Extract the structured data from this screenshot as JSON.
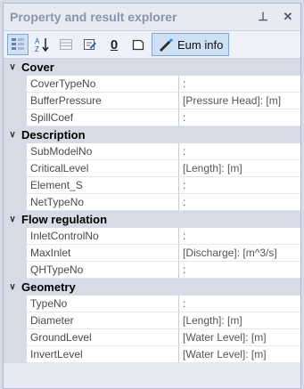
{
  "window": {
    "title": "Property and result explorer",
    "pin_glyph": "⊥",
    "close_glyph": "✕"
  },
  "toolbar": {
    "categorized_icon": "categorized-icon",
    "sort_glyph": "A↓Z",
    "grid_icon": "grid-icon",
    "edit_icon": "edit-icon",
    "zero_glyph": "0",
    "page_icon": "page-icon",
    "eum_label": "Eum info"
  },
  "categories": [
    {
      "name": "Cover",
      "rows": [
        {
          "name": "CoverTypeNo",
          "value": ":"
        },
        {
          "name": "BufferPressure",
          "value": "[Pressure Head]: [m]"
        },
        {
          "name": "SpillCoef",
          "value": ":"
        }
      ]
    },
    {
      "name": "Description",
      "rows": [
        {
          "name": "SubModelNo",
          "value": ":"
        },
        {
          "name": "CriticalLevel",
          "value": "[Length]: [m]"
        },
        {
          "name": "Element_S",
          "value": ":"
        },
        {
          "name": "NetTypeNo",
          "value": ":"
        }
      ]
    },
    {
      "name": "Flow regulation",
      "rows": [
        {
          "name": "InletControlNo",
          "value": ":"
        },
        {
          "name": "MaxInlet",
          "value": "[Discharge]: [m^3/s]"
        },
        {
          "name": "QHTypeNo",
          "value": ":"
        }
      ]
    },
    {
      "name": "Geometry",
      "rows": [
        {
          "name": "TypeNo",
          "value": ":"
        },
        {
          "name": "Diameter",
          "value": "[Length]: [m]"
        },
        {
          "name": "GroundLevel",
          "value": "[Water Level]: [m]"
        },
        {
          "name": "InvertLevel",
          "value": "[Water Level]: [m]"
        }
      ]
    }
  ],
  "chevron_glyph": "∨"
}
